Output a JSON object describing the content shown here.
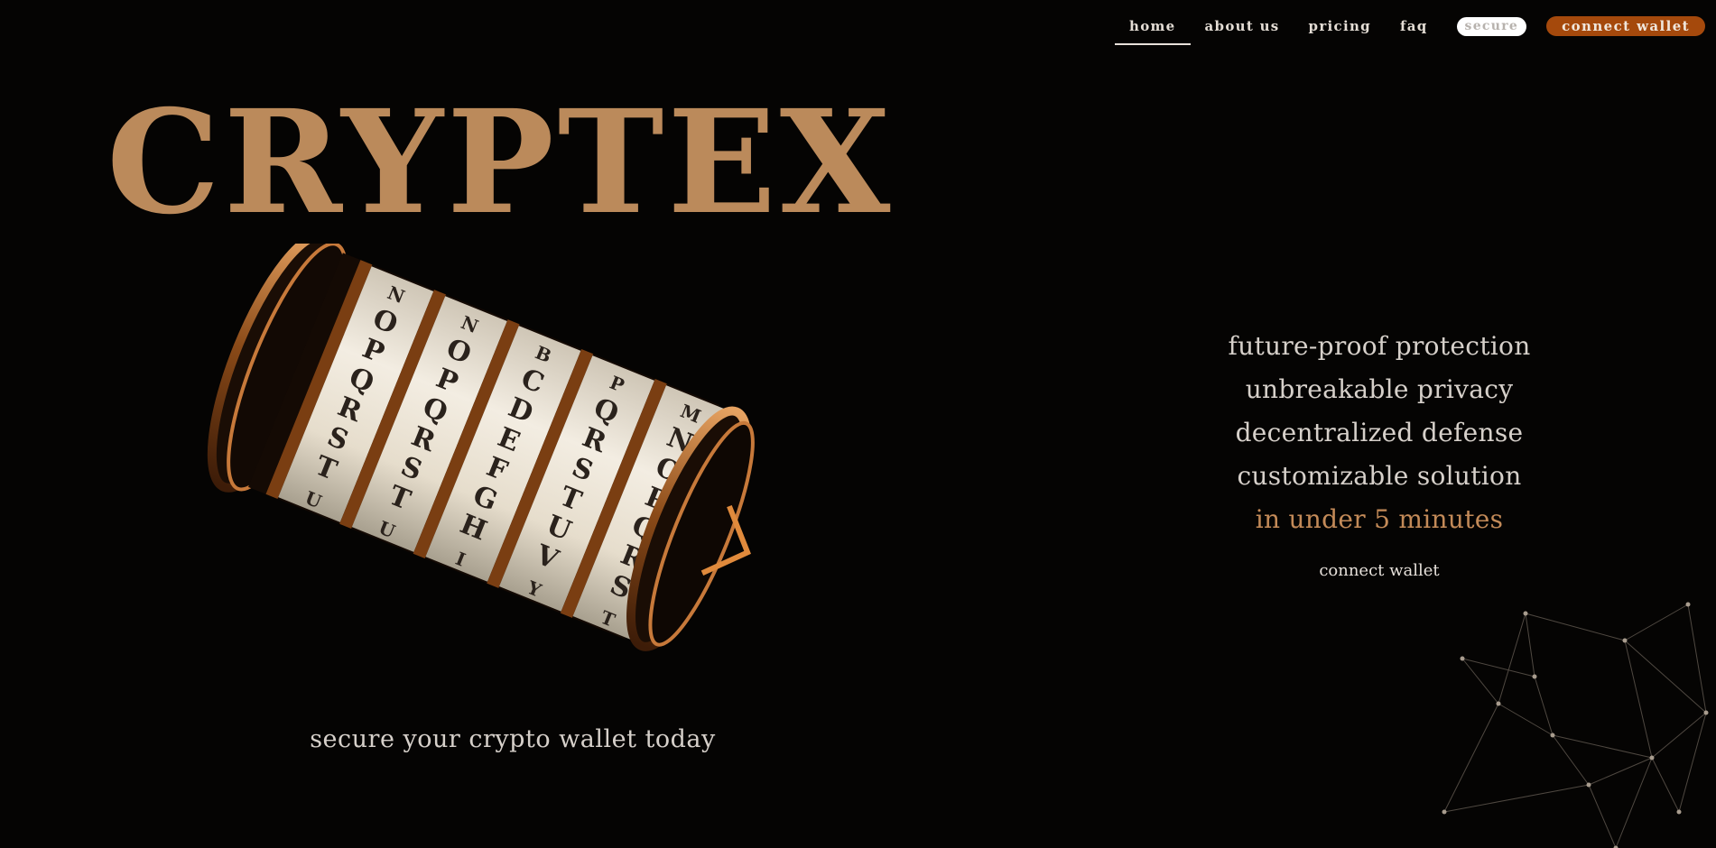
{
  "nav": {
    "links": [
      {
        "label": "home",
        "active": true
      },
      {
        "label": "about us",
        "active": false
      },
      {
        "label": "pricing",
        "active": false
      },
      {
        "label": "faq",
        "active": false
      }
    ],
    "secure_label": "secure",
    "connect_label": "connect wallet"
  },
  "hero": {
    "brand": "CRYPTEX",
    "subtitle": "secure your crypto wallet today"
  },
  "cryptex_rings": [
    [
      "N",
      "O",
      "P",
      "Q",
      "R",
      "S",
      "T",
      "U"
    ],
    [
      "N",
      "O",
      "P",
      "Q",
      "R",
      "S",
      "T",
      "U"
    ],
    [
      "B",
      "C",
      "D",
      "E",
      "F",
      "G",
      "H",
      "I"
    ],
    [
      "P",
      "Q",
      "R",
      "S",
      "T",
      "U",
      "V",
      "Y"
    ],
    [
      "M",
      "N",
      "O",
      "P",
      "Q",
      "R",
      "S",
      "T"
    ]
  ],
  "features": {
    "items": [
      "future-proof protection",
      "unbreakable privacy",
      "decentralized defense",
      "customizable solution"
    ],
    "highlight": "in under 5 minutes",
    "cta_label": "connect wallet"
  },
  "colors": {
    "background": "#050403",
    "brand": "#bb8a5b",
    "accent_button": "#a5490c",
    "highlight_text": "#c38a58"
  }
}
